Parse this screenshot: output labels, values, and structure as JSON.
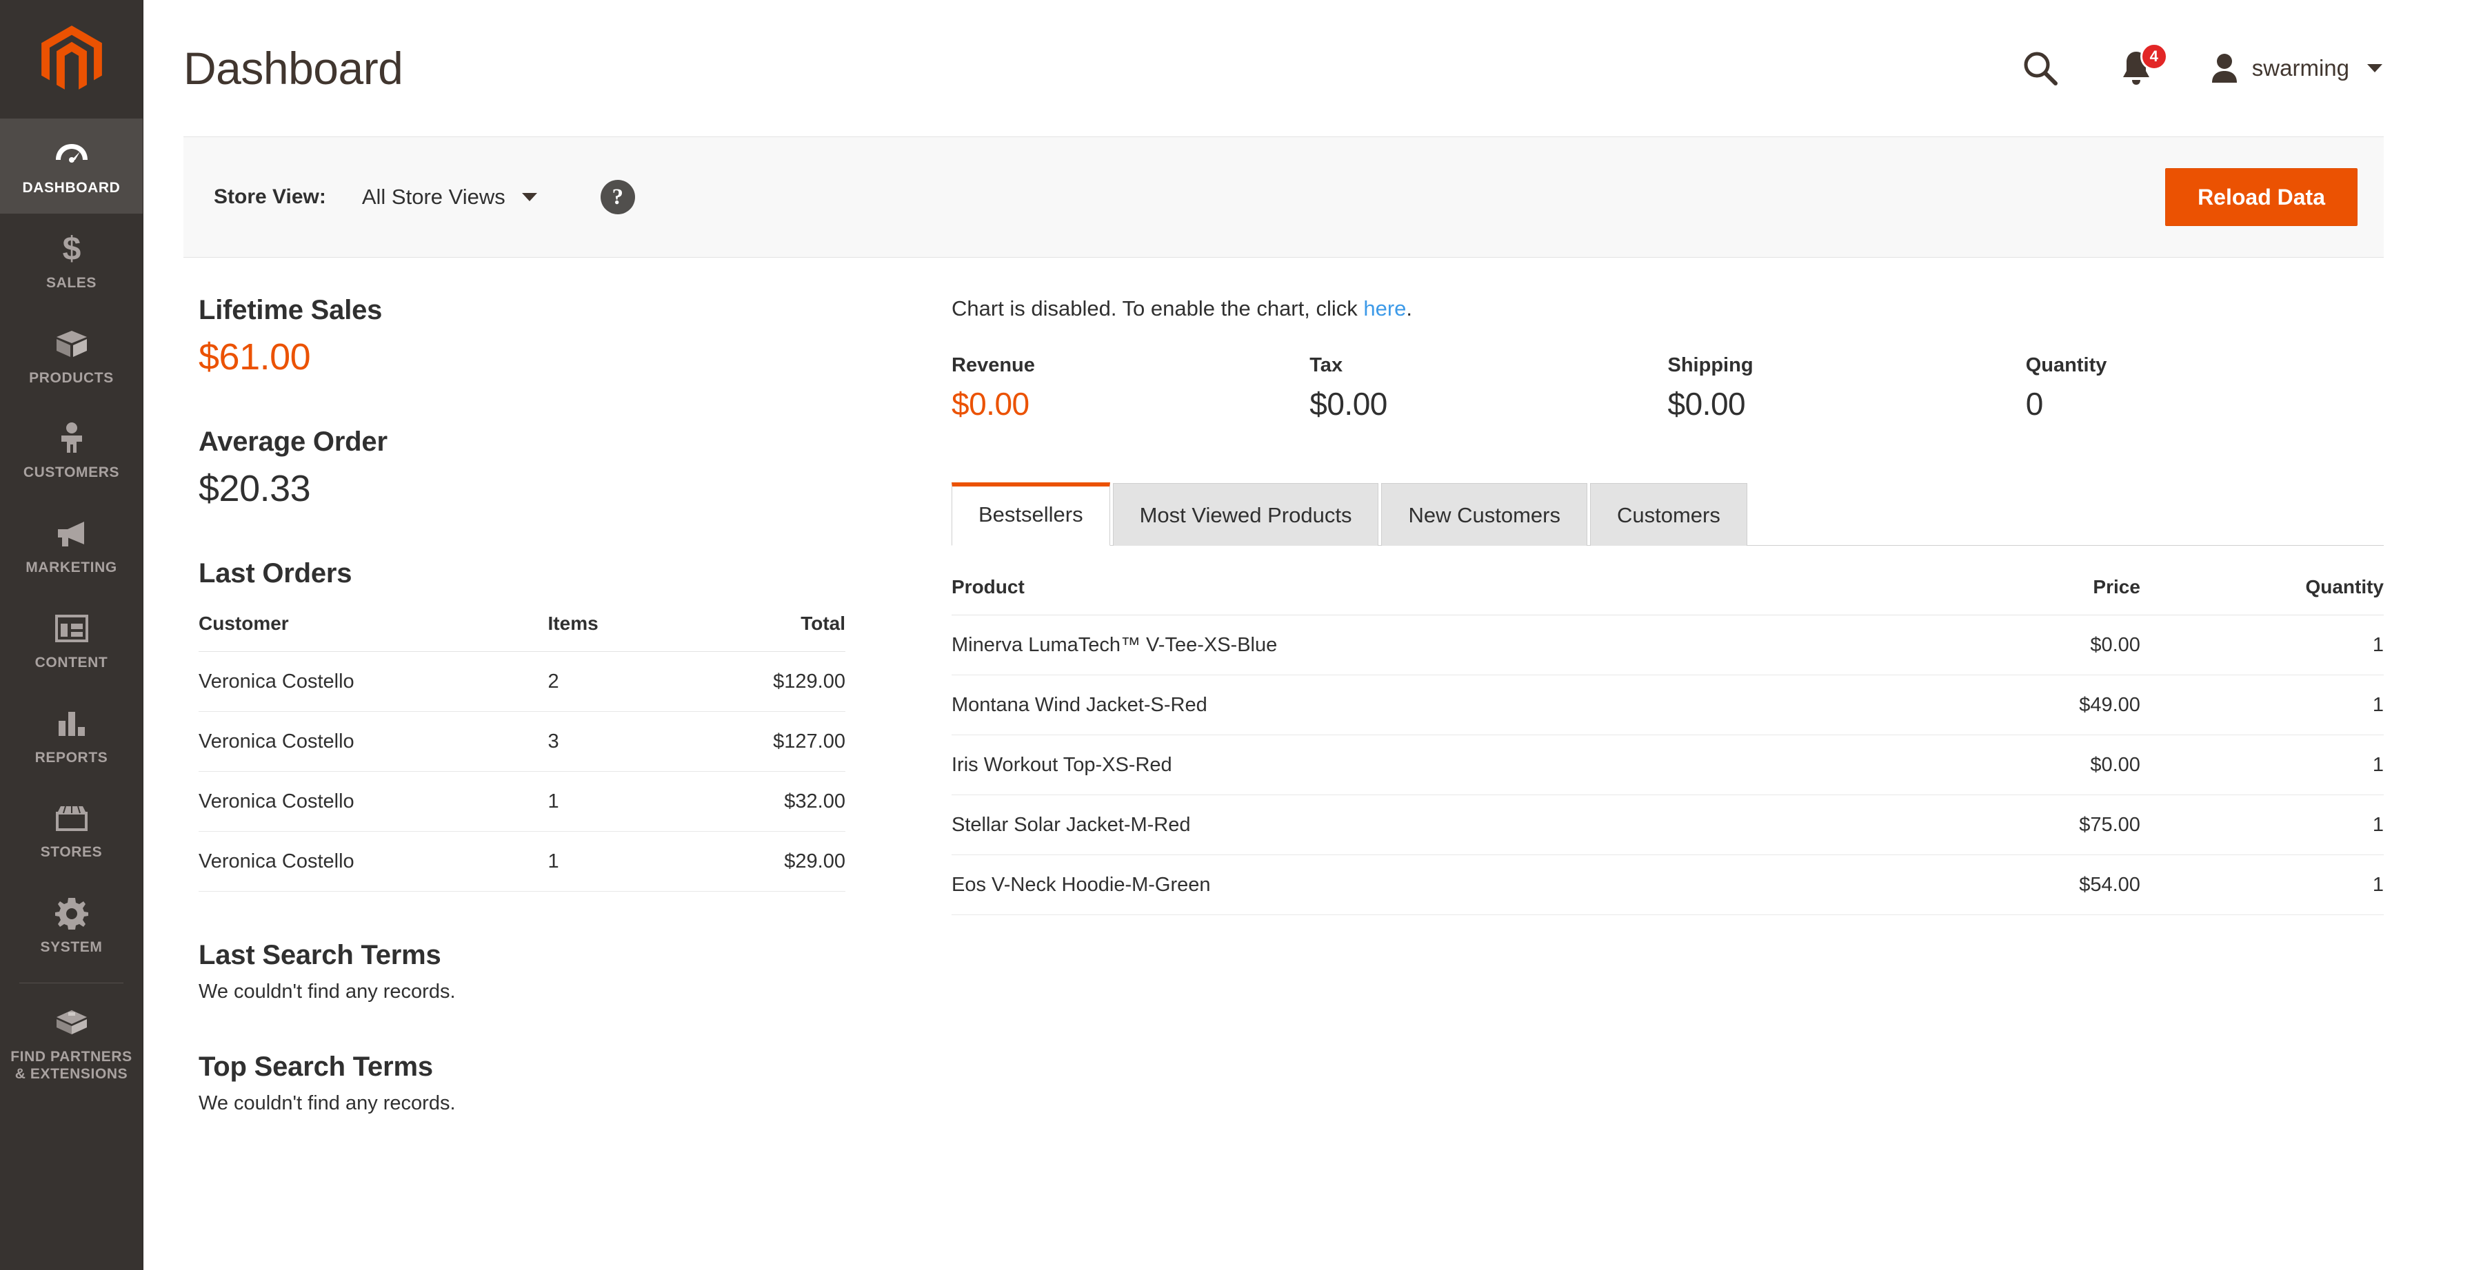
{
  "sidebar": {
    "logo": "magento-logo",
    "items": [
      {
        "label": "DASHBOARD",
        "icon": "dashboard-gauge-icon",
        "active": true
      },
      {
        "label": "SALES",
        "icon": "dollar-icon",
        "active": false
      },
      {
        "label": "PRODUCTS",
        "icon": "box-icon",
        "active": false
      },
      {
        "label": "CUSTOMERS",
        "icon": "person-icon",
        "active": false
      },
      {
        "label": "MARKETING",
        "icon": "megaphone-icon",
        "active": false
      },
      {
        "label": "CONTENT",
        "icon": "layout-icon",
        "active": false
      },
      {
        "label": "REPORTS",
        "icon": "bar-chart-icon",
        "active": false
      },
      {
        "label": "STORES",
        "icon": "storefront-icon",
        "active": false
      },
      {
        "label": "SYSTEM",
        "icon": "gear-icon",
        "active": false
      },
      {
        "label": "FIND PARTNERS\n& EXTENSIONS",
        "icon": "package-icon",
        "active": false
      }
    ]
  },
  "header": {
    "title": "Dashboard",
    "search_icon": "search-icon",
    "notifications_icon": "bell-icon",
    "notifications_count": "4",
    "user_icon": "user-avatar-icon",
    "user_name": "swarming",
    "caret_icon": "chevron-down-icon"
  },
  "storebar": {
    "store_view_label": "Store View:",
    "store_view_value": "All Store Views",
    "store_view_caret": "chevron-down-icon",
    "help_icon": "question-mark-icon",
    "help_glyph": "?",
    "reload_label": "Reload Data"
  },
  "left": {
    "lifetime_sales_title": "Lifetime Sales",
    "lifetime_sales_value": "$61.00",
    "average_order_title": "Average Order",
    "average_order_value": "$20.33",
    "last_orders_title": "Last Orders",
    "orders_columns": [
      "Customer",
      "Items",
      "Total"
    ],
    "orders": [
      {
        "customer": "Veronica Costello",
        "items": "2",
        "total": "$129.00"
      },
      {
        "customer": "Veronica Costello",
        "items": "3",
        "total": "$127.00"
      },
      {
        "customer": "Veronica Costello",
        "items": "1",
        "total": "$32.00"
      },
      {
        "customer": "Veronica Costello",
        "items": "1",
        "total": "$29.00"
      }
    ],
    "last_search_title": "Last Search Terms",
    "last_search_empty": "We couldn't find any records.",
    "top_search_title": "Top Search Terms",
    "top_search_empty": "We couldn't find any records."
  },
  "right": {
    "chart_note_prefix": "Chart is disabled. To enable the chart, click ",
    "chart_note_link": "here",
    "chart_note_suffix": ".",
    "stats": [
      {
        "label": "Revenue",
        "value": "$0.00",
        "accent": true
      },
      {
        "label": "Tax",
        "value": "$0.00",
        "accent": false
      },
      {
        "label": "Shipping",
        "value": "$0.00",
        "accent": false
      },
      {
        "label": "Quantity",
        "value": "0",
        "accent": false
      }
    ],
    "tabs": [
      {
        "label": "Bestsellers",
        "active": true
      },
      {
        "label": "Most Viewed Products",
        "active": false
      },
      {
        "label": "New Customers",
        "active": false
      },
      {
        "label": "Customers",
        "active": false
      }
    ],
    "product_columns": [
      "Product",
      "Price",
      "Quantity"
    ],
    "products": [
      {
        "product": "Minerva LumaTech™ V-Tee-XS-Blue",
        "price": "$0.00",
        "quantity": "1"
      },
      {
        "product": "Montana Wind Jacket-S-Red",
        "price": "$49.00",
        "quantity": "1"
      },
      {
        "product": "Iris Workout Top-XS-Red",
        "price": "$0.00",
        "quantity": "1"
      },
      {
        "product": "Stellar Solar Jacket-M-Red",
        "price": "$75.00",
        "quantity": "1"
      },
      {
        "product": "Eos V-Neck Hoodie-M-Green",
        "price": "$54.00",
        "quantity": "1"
      }
    ]
  },
  "colors": {
    "accent_orange": "#eb5202",
    "sidebar_bg": "#373330",
    "sidebar_active_bg": "#4f4b48",
    "link_blue": "#3d9ae8",
    "badge_red": "#e22626",
    "text_dark": "#303030"
  }
}
